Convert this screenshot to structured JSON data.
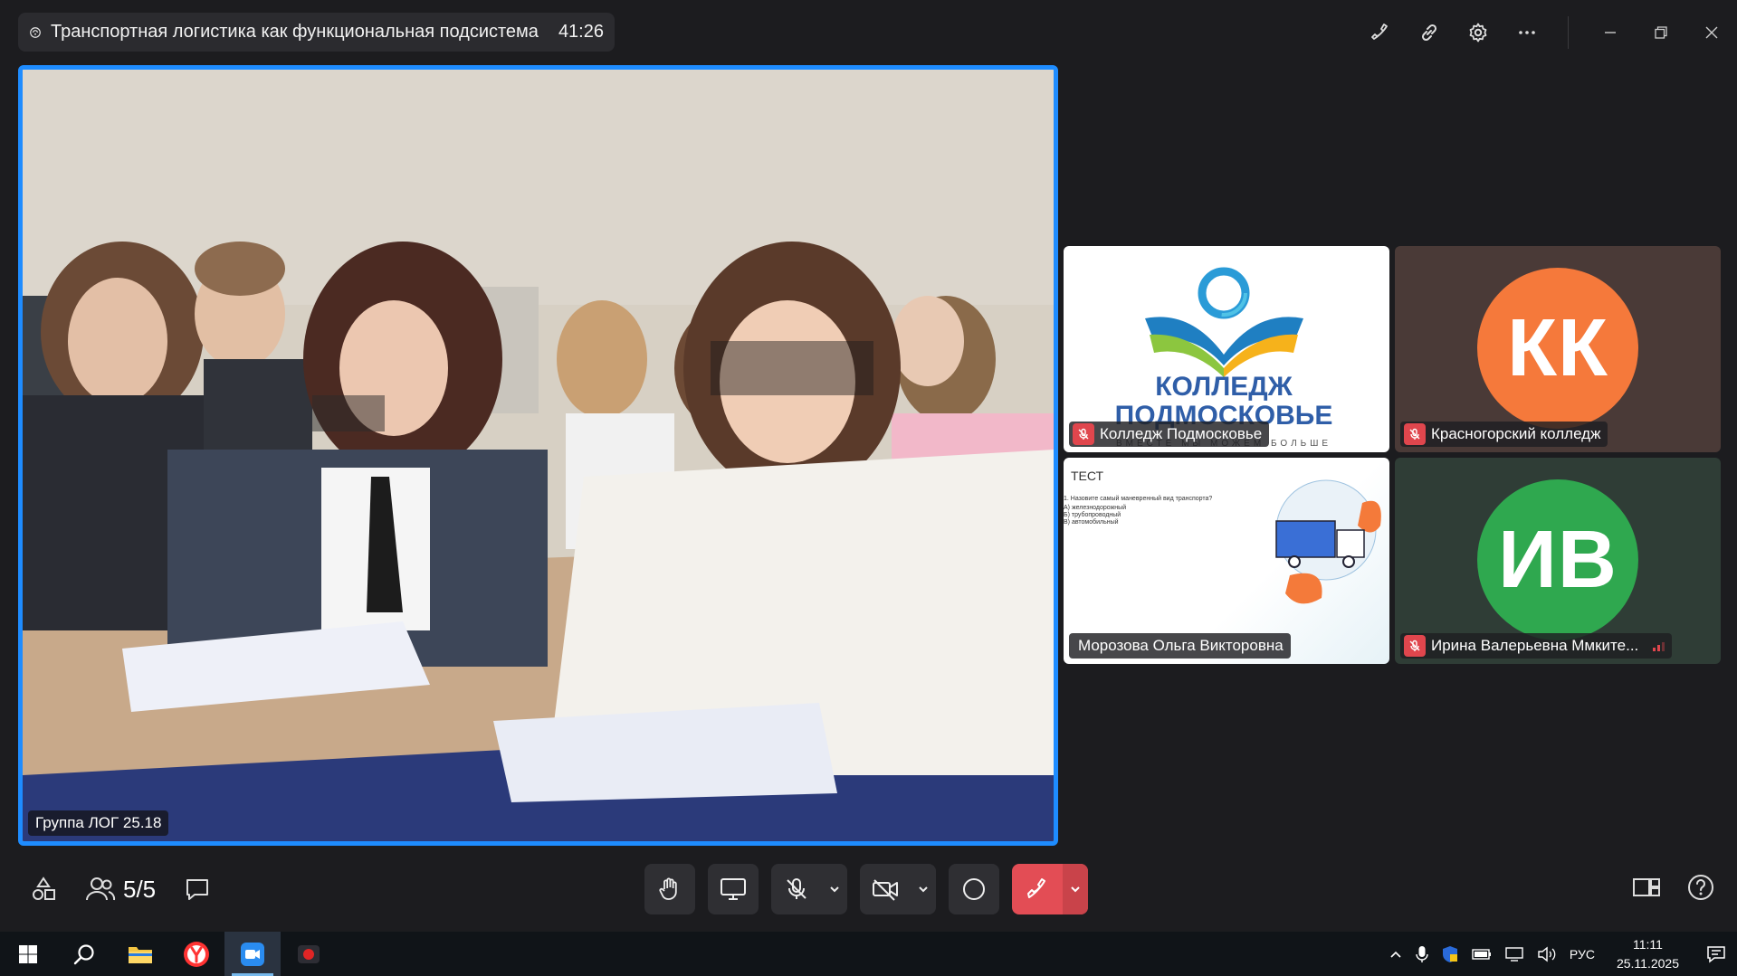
{
  "header": {
    "title": "Транспортная логистика как функциональная подсистема",
    "timer": "41:26"
  },
  "main_video": {
    "label": "Группа ЛОГ 25.18"
  },
  "tiles": [
    {
      "name": "Колледж Подмосковье",
      "muted": true,
      "logo_line1": "КОЛЛЕДЖ",
      "logo_line2": "ПОДМОСКОВЬЕ",
      "logo_tagline": "ВМЕСТЕ МЫ МОЖЕМ БОЛЬШЕ"
    },
    {
      "name": "Красногорский колледж",
      "muted": true,
      "initials": "КК",
      "avatar_color": "#f5793b",
      "tile_bg": "#4a3a37"
    },
    {
      "name": "Морозова Ольга Викторовна",
      "muted": false,
      "slide_title": "ТЕСТ",
      "slide_question": "1. Назовите самый маневренный вид транспорта?",
      "slide_options": [
        "А) железнодорожный",
        "Б) трубопроводный",
        "В) автомобильный"
      ]
    },
    {
      "name": "Ирина Валерьевна Ммките...",
      "muted": true,
      "initials": "ИВ",
      "avatar_color": "#2fa84f",
      "tile_bg": "#2f3d36"
    }
  ],
  "controls": {
    "participants_count": "5/5"
  },
  "taskbar": {
    "language": "РУС",
    "time": "11:11",
    "date": "25.11.2025"
  },
  "colors": {
    "active_speaker_border": "#1e8cff",
    "hangup": "#e34d55",
    "mute_badge": "#e0464d"
  }
}
